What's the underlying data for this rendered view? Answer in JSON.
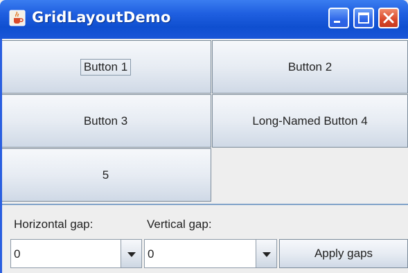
{
  "window": {
    "title": "GridLayoutDemo",
    "icon": "java-cup-icon",
    "controls": {
      "minimize": "minimize-icon",
      "maximize": "maximize-icon",
      "close": "close-icon"
    }
  },
  "grid": {
    "buttons": [
      {
        "label": "Button 1",
        "focused": true
      },
      {
        "label": "Button 2"
      },
      {
        "label": "Button 3"
      },
      {
        "label": "Long-Named Button 4"
      },
      {
        "label": "5"
      }
    ]
  },
  "controls": {
    "horizontal_gap_label": "Horizontal gap:",
    "vertical_gap_label": "Vertical gap:",
    "horizontal_gap_value": "0",
    "vertical_gap_value": "0",
    "apply_label": "Apply gaps"
  },
  "colors": {
    "titlebar": "#1f5fe0",
    "close_button": "#d9482a",
    "background": "#eeeeee",
    "separator": "#7fa2c8"
  }
}
